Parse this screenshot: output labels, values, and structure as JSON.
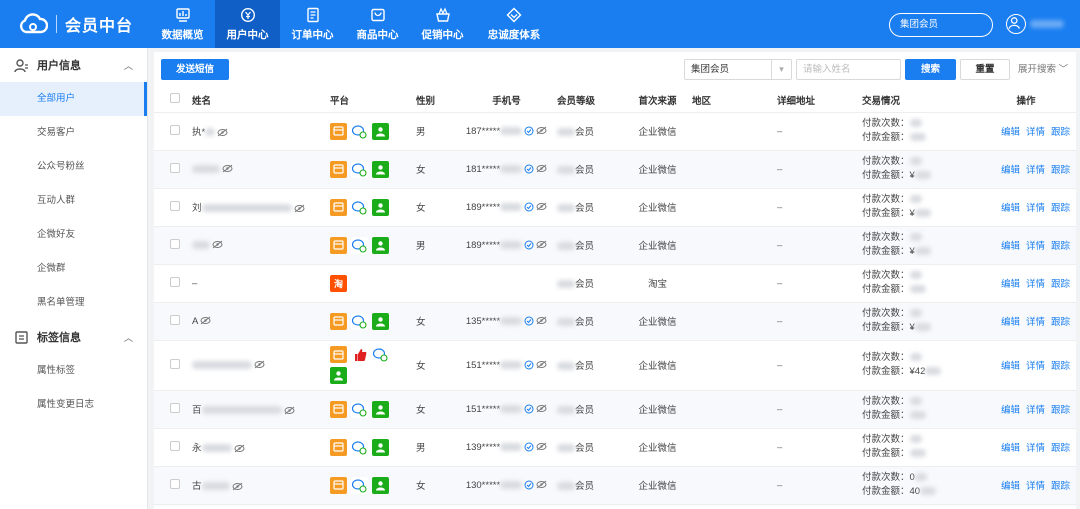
{
  "app": {
    "title": "会员中台"
  },
  "nav": [
    {
      "label": "数据概览",
      "icon": "dashboard-icon"
    },
    {
      "label": "用户中心",
      "icon": "user-center-icon",
      "active": true
    },
    {
      "label": "订单中心",
      "icon": "order-icon"
    },
    {
      "label": "商品中心",
      "icon": "goods-icon"
    },
    {
      "label": "促销中心",
      "icon": "promotion-icon"
    },
    {
      "label": "忠诚度体系",
      "icon": "loyalty-icon"
    }
  ],
  "top_select": "集团会员",
  "sidebar": {
    "groups": [
      {
        "label": "用户信息",
        "icon": "user-info-icon",
        "items": [
          "全部用户",
          "交易客户",
          "公众号粉丝",
          "互动人群",
          "企微好友",
          "企微群",
          "黑名单管理"
        ],
        "active": "全部用户"
      },
      {
        "label": "标签信息",
        "icon": "tag-info-icon",
        "items": [
          "属性标签",
          "属性变更日志"
        ]
      }
    ]
  },
  "toolbar": {
    "send_sms": "发送短信",
    "group_select": "集团会员",
    "name_placeholder": "请输入姓名",
    "search": "搜索",
    "reset": "重置",
    "expand": "展开搜索"
  },
  "table": {
    "headers": [
      "姓名",
      "平台",
      "性别",
      "手机号",
      "会员等级",
      "首次来源",
      "地区",
      "详细地址",
      "交易情况",
      "操作"
    ],
    "trade_labels": [
      "付款次数：",
      "付款金额："
    ],
    "ops": [
      "编辑",
      "详情",
      "跟踪"
    ],
    "rows": [
      {
        "name": "执*",
        "platforms": [
          "shop",
          "wechat",
          "user"
        ],
        "gender": "男",
        "phone": "187*****",
        "level": "会员",
        "source": "企业微信",
        "address": "–",
        "count": "",
        "amount": ""
      },
      {
        "name": "",
        "platforms": [
          "shop",
          "wechat",
          "user"
        ],
        "gender": "女",
        "phone": "181*****",
        "level": "会员",
        "source": "企业微信",
        "address": "–",
        "count": "",
        "amount": "¥"
      },
      {
        "name": "刘",
        "platforms": [
          "shop",
          "wechat",
          "user"
        ],
        "gender": "女",
        "phone": "189*****",
        "level": "会员",
        "source": "企业微信",
        "address": "–",
        "count": "",
        "amount": "¥"
      },
      {
        "name": "",
        "platforms": [
          "shop",
          "wechat",
          "user"
        ],
        "gender": "男",
        "phone": "189*****",
        "level": "会员",
        "source": "企业微信",
        "address": "–",
        "count": "",
        "amount": "¥"
      },
      {
        "name": "–",
        "platforms": [
          "taobao"
        ],
        "gender": "",
        "phone": "",
        "level": "会员",
        "source": "淘宝",
        "address": "–",
        "count": "",
        "amount": ""
      },
      {
        "name": "A",
        "platforms": [
          "shop",
          "wechat",
          "user"
        ],
        "gender": "女",
        "phone": "135*****",
        "level": "会员",
        "source": "企业微信",
        "address": "–",
        "count": "",
        "amount": "¥"
      },
      {
        "name": "",
        "platforms": [
          "shop",
          "thumb",
          "wechat",
          "user"
        ],
        "gender": "女",
        "phone": "151*****",
        "level": "会员",
        "source": "企业微信",
        "address": "–",
        "count": "",
        "amount": "¥42"
      },
      {
        "name": "百",
        "platforms": [
          "shop",
          "wechat",
          "user"
        ],
        "gender": "女",
        "phone": "151*****",
        "level": "会员",
        "source": "企业微信",
        "address": "–",
        "count": "",
        "amount": ""
      },
      {
        "name": "永",
        "platforms": [
          "shop",
          "wechat",
          "user"
        ],
        "gender": "男",
        "phone": "139*****",
        "level": "会员",
        "source": "企业微信",
        "address": "–",
        "count": "",
        "amount": ""
      },
      {
        "name": "古",
        "platforms": [
          "shop",
          "wechat",
          "user"
        ],
        "gender": "女",
        "phone": "130*****",
        "level": "会员",
        "source": "企业微信",
        "address": "–",
        "count": "0",
        "amount": "40"
      }
    ]
  },
  "colors": {
    "primary": "#1a7ef0",
    "nav_active": "#0f5fc7",
    "shop": "#f59a23",
    "wecom": "#1aad19",
    "taobao": "#ff5000"
  }
}
